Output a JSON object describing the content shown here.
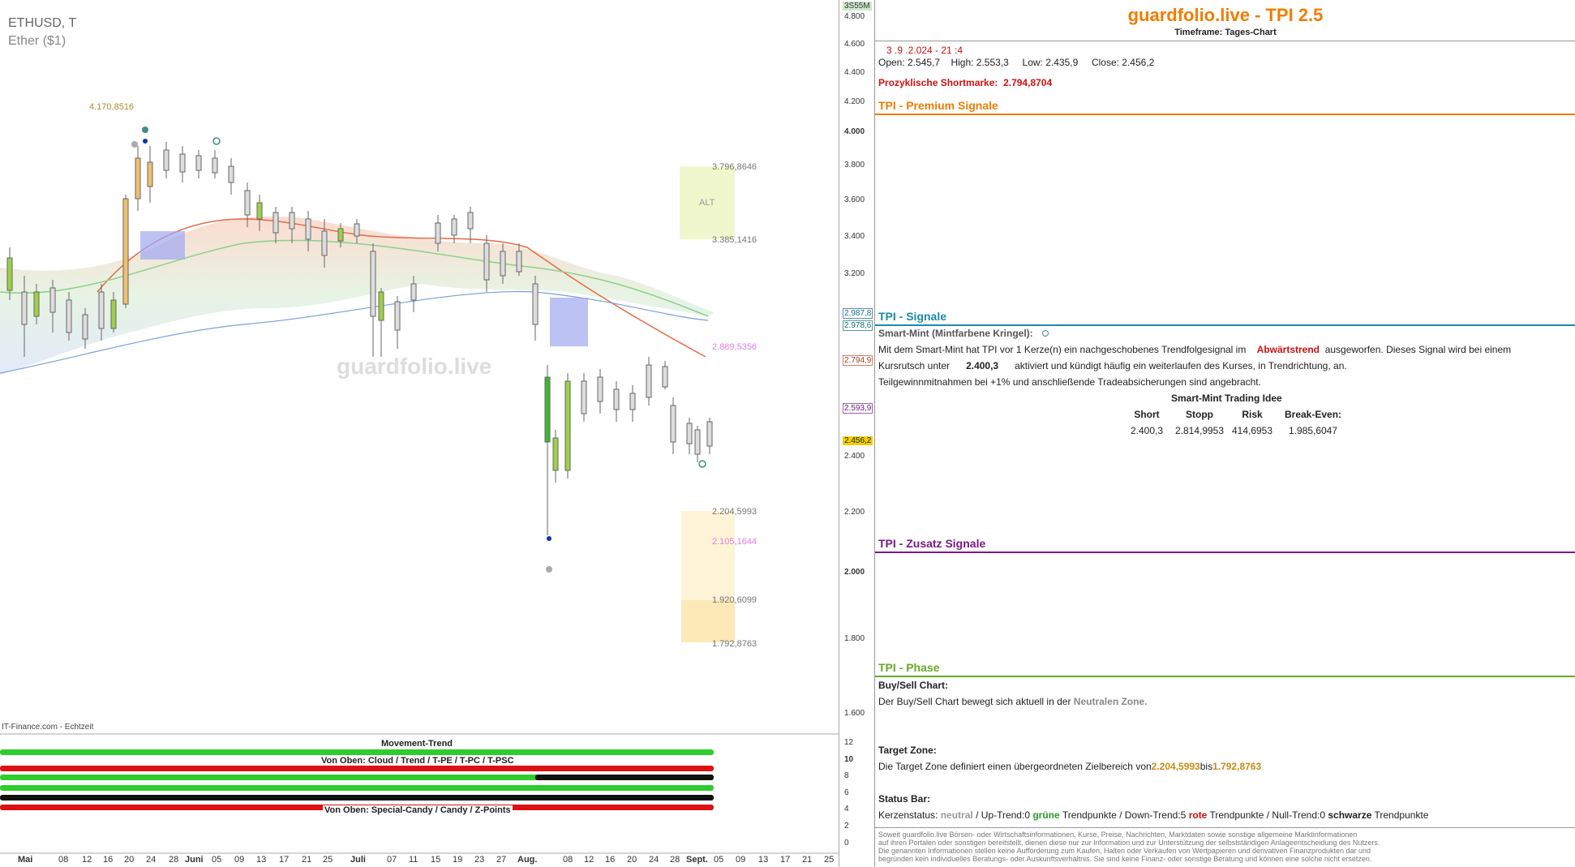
{
  "chart": {
    "symbol": "ETHUSD, T",
    "name": "Ether ($1)",
    "watermark": "guardfolio.live",
    "source": "IT-Finance.com - Echtzeit",
    "price_badge": "3S55M",
    "price_ticks": [
      "4.800",
      "4.600",
      "4.400",
      "4.200",
      "4.000",
      "3.800",
      "3.600",
      "3.400",
      "3.200",
      "2.400",
      "2.200",
      "2.000",
      "1.800",
      "1.600"
    ],
    "price_labels": {
      "p1": "2.987,8",
      "p2": "2.978,6",
      "p3": "2.794,9",
      "p4": "2.593,9",
      "p5": "2.456,2"
    },
    "annotations": {
      "high_label": "4.170,8516",
      "alt_top": "3.796,8646",
      "alt_label": "ALT",
      "alt_bottom": "3.385,1416",
      "short_line": "2.889,5356",
      "target_1": "2.204,5993",
      "target_2": "2.105,1644",
      "target_3": "1.920,6099",
      "target_4": "1.792,8763"
    },
    "dates": [
      "Mai",
      "08",
      "12",
      "16",
      "20",
      "24",
      "28",
      "Juni",
      "05",
      "09",
      "13",
      "17",
      "21",
      "25",
      "Juli",
      "07",
      "11",
      "15",
      "19",
      "23",
      "27",
      "Aug.",
      "08",
      "12",
      "16",
      "20",
      "24",
      "28",
      "Sept.",
      "05",
      "09",
      "13",
      "17",
      "21",
      "25"
    ],
    "movement_title": "Movement-Trend",
    "indicator_label_1": "Von Oben: Cloud / Trend / T-PE / T-PC / T-PSC",
    "indicator_label_2": "Von Oben: Special-Candy / Candy / Z-Points",
    "indicator_ticks": [
      "12",
      "10",
      "8",
      "6",
      "4",
      "2",
      "0"
    ]
  },
  "panel": {
    "title": "guardfolio.live - TPI 2.5",
    "timeframe": "Timeframe: Tages-Chart",
    "datetime": "3 .9 .2.024  - 21 :4",
    "ohlc": {
      "open_label": "Open:",
      "open": "2.545,7",
      "high_label": "High:",
      "high": "2.553,3",
      "low_label": "Low:",
      "low": "2.435,9",
      "close_label": "Close:",
      "close": "2.456,2"
    },
    "shortmark_label": "Prozyklische Shortmarke:",
    "shortmark_value": "2.794,8704",
    "sec_premium": "TPI - Premium Signale",
    "sec_signale": "TPI - Signale",
    "smartmint_title": "Smart-Mint (Mintfarbene Kringel):",
    "sm_text_1": "Mit dem Smart-Mint hat TPI vor 1  Kerze(n) ein nachgeschobenes Trendfolgesignal im",
    "sm_trend": "Abwärtstrend",
    "sm_text_2": "ausgeworfen. Dieses Signal wird bei einem",
    "sm_text_3": "Kursrutsch unter",
    "sm_level": "2.400,3",
    "sm_text_4": "aktiviert und kündigt häufig ein weiterlaufen des Kurses, in Trendrichtung, an.",
    "sm_text_5": "Teilgewinnmitnahmen bei +1% und anschließende Tradeabsicherungen sind angebracht.",
    "idea_title": "Smart-Mint Trading Idee",
    "idea_headers": [
      "Short",
      "Stopp",
      "Risk",
      "Break-Even:"
    ],
    "idea_values": [
      "2.400,3",
      "2.814,9953",
      "414,6953",
      "1.985,6047"
    ],
    "sec_zusatz": "TPI - Zusatz Signale",
    "sec_phase": "TPI - Phase",
    "buysell_title": "Buy/Sell Chart:",
    "buysell_text": "Der Buy/Sell Chart bewegt sich aktuell in der",
    "buysell_zone": "Neutralen Zone.",
    "target_title": "Target Zone:",
    "target_text": "Die Target Zone definiert einen übergeordneten Zielbereich von",
    "target_from": "2.204,5993",
    "target_bis": "bis",
    "target_to": "1.792,8763",
    "status_title": "Status Bar:",
    "status_k": "Kerzenstatus:",
    "status_neutral": "neutral",
    "status_up": "/ Up-Trend:0",
    "status_gruene": "grüne",
    "status_tp1": "Trendpunkte  / Down-Trend:5",
    "status_rote": "rote",
    "status_tp2": "Trendpunkte / Null-Trend:0",
    "status_schwarze": "schwarze",
    "status_tp3": "Trendpunkte",
    "disclaimer_1": "Soweit guardfolio.live Börsen- oder Wirtschaftsinformationen, Kurse, Preise, Nachrichten, Marktdaten sowie sonstige allgemeine Marktinformationen",
    "disclaimer_2": "auf ihren Portalen oder sonstigen bereitstellt, dienen diese nur zur Information und zur Unterstützung der selbstständigen Anlageentscheidung des Nutzers.",
    "disclaimer_3": "Die genannten Informationen stellen keine Aufforderung zum Kaufen, Halten oder Verkaufen von Wertpapieren und derivativen Finanzprodukten dar und",
    "disclaimer_4": "begründen kein individuelles Beratungs- oder Auskunftsverhältnis. Sie sind keine Finanz- oder sonstige Beratung und können eine solche nicht ersetzen."
  },
  "colors": {
    "accent": "#f07d00",
    "premium": "#f07d00",
    "signale": "#1a8aa8",
    "zusatz": "#7a1a86",
    "phase": "#6aa82a",
    "red": "#cc1111",
    "gold": "#c88a16"
  }
}
